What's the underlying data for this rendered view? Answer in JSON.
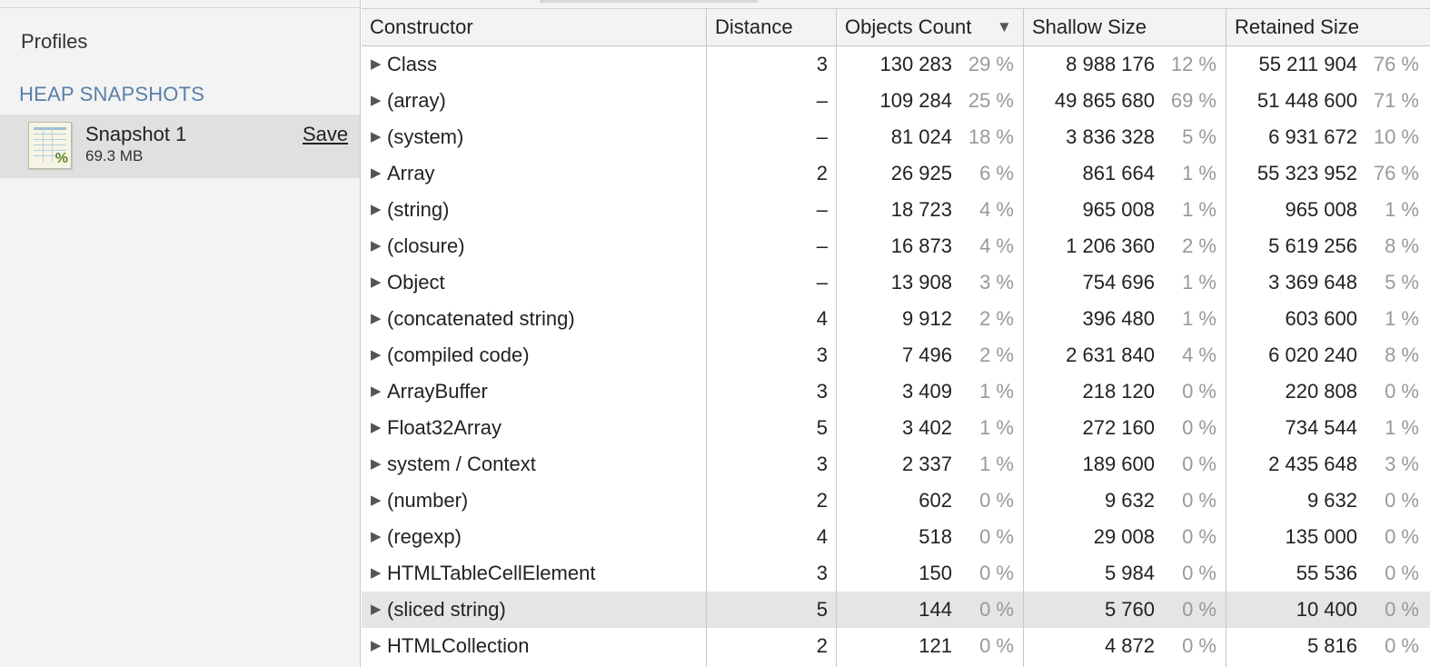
{
  "sidebar": {
    "title": "Profiles",
    "section_header": "HEAP SNAPSHOTS",
    "snapshot": {
      "name": "Snapshot 1",
      "size": "69.3 MB",
      "save_label": "Save",
      "icon": "spreadsheet-percent-icon"
    }
  },
  "grid": {
    "columns": {
      "constructor": "Constructor",
      "distance": "Distance",
      "objects_count": "Objects Count",
      "shallow_size": "Shallow Size",
      "retained_size": "Retained Size"
    },
    "sort_indicator": "▼",
    "selected_row": 15,
    "rows": [
      {
        "name": "Class",
        "distance": "3",
        "count": "130 283",
        "count_pct": "29 %",
        "shallow": "8 988 176",
        "shallow_pct": "12 %",
        "retained": "55 211 904",
        "retained_pct": "76 %"
      },
      {
        "name": "(array)",
        "distance": "–",
        "count": "109 284",
        "count_pct": "25 %",
        "shallow": "49 865 680",
        "shallow_pct": "69 %",
        "retained": "51 448 600",
        "retained_pct": "71 %"
      },
      {
        "name": "(system)",
        "distance": "–",
        "count": "81 024",
        "count_pct": "18 %",
        "shallow": "3 836 328",
        "shallow_pct": "5 %",
        "retained": "6 931 672",
        "retained_pct": "10 %"
      },
      {
        "name": "Array",
        "distance": "2",
        "count": "26 925",
        "count_pct": "6 %",
        "shallow": "861 664",
        "shallow_pct": "1 %",
        "retained": "55 323 952",
        "retained_pct": "76 %"
      },
      {
        "name": "(string)",
        "distance": "–",
        "count": "18 723",
        "count_pct": "4 %",
        "shallow": "965 008",
        "shallow_pct": "1 %",
        "retained": "965 008",
        "retained_pct": "1 %"
      },
      {
        "name": "(closure)",
        "distance": "–",
        "count": "16 873",
        "count_pct": "4 %",
        "shallow": "1 206 360",
        "shallow_pct": "2 %",
        "retained": "5 619 256",
        "retained_pct": "8 %"
      },
      {
        "name": "Object",
        "distance": "–",
        "count": "13 908",
        "count_pct": "3 %",
        "shallow": "754 696",
        "shallow_pct": "1 %",
        "retained": "3 369 648",
        "retained_pct": "5 %"
      },
      {
        "name": "(concatenated string)",
        "distance": "4",
        "count": "9 912",
        "count_pct": "2 %",
        "shallow": "396 480",
        "shallow_pct": "1 %",
        "retained": "603 600",
        "retained_pct": "1 %"
      },
      {
        "name": "(compiled code)",
        "distance": "3",
        "count": "7 496",
        "count_pct": "2 %",
        "shallow": "2 631 840",
        "shallow_pct": "4 %",
        "retained": "6 020 240",
        "retained_pct": "8 %"
      },
      {
        "name": "ArrayBuffer",
        "distance": "3",
        "count": "3 409",
        "count_pct": "1 %",
        "shallow": "218 120",
        "shallow_pct": "0 %",
        "retained": "220 808",
        "retained_pct": "0 %"
      },
      {
        "name": "Float32Array",
        "distance": "5",
        "count": "3 402",
        "count_pct": "1 %",
        "shallow": "272 160",
        "shallow_pct": "0 %",
        "retained": "734 544",
        "retained_pct": "1 %"
      },
      {
        "name": "system / Context",
        "distance": "3",
        "count": "2 337",
        "count_pct": "1 %",
        "shallow": "189 600",
        "shallow_pct": "0 %",
        "retained": "2 435 648",
        "retained_pct": "3 %"
      },
      {
        "name": "(number)",
        "distance": "2",
        "count": "602",
        "count_pct": "0 %",
        "shallow": "9 632",
        "shallow_pct": "0 %",
        "retained": "9 632",
        "retained_pct": "0 %"
      },
      {
        "name": "(regexp)",
        "distance": "4",
        "count": "518",
        "count_pct": "0 %",
        "shallow": "29 008",
        "shallow_pct": "0 %",
        "retained": "135 000",
        "retained_pct": "0 %"
      },
      {
        "name": "HTMLTableCellElement",
        "distance": "3",
        "count": "150",
        "count_pct": "0 %",
        "shallow": "5 984",
        "shallow_pct": "0 %",
        "retained": "55 536",
        "retained_pct": "0 %"
      },
      {
        "name": "(sliced string)",
        "distance": "5",
        "count": "144",
        "count_pct": "0 %",
        "shallow": "5 760",
        "shallow_pct": "0 %",
        "retained": "10 400",
        "retained_pct": "0 %"
      },
      {
        "name": "HTMLCollection",
        "distance": "2",
        "count": "121",
        "count_pct": "0 %",
        "shallow": "4 872",
        "shallow_pct": "0 %",
        "retained": "5 816",
        "retained_pct": "0 %"
      }
    ]
  }
}
